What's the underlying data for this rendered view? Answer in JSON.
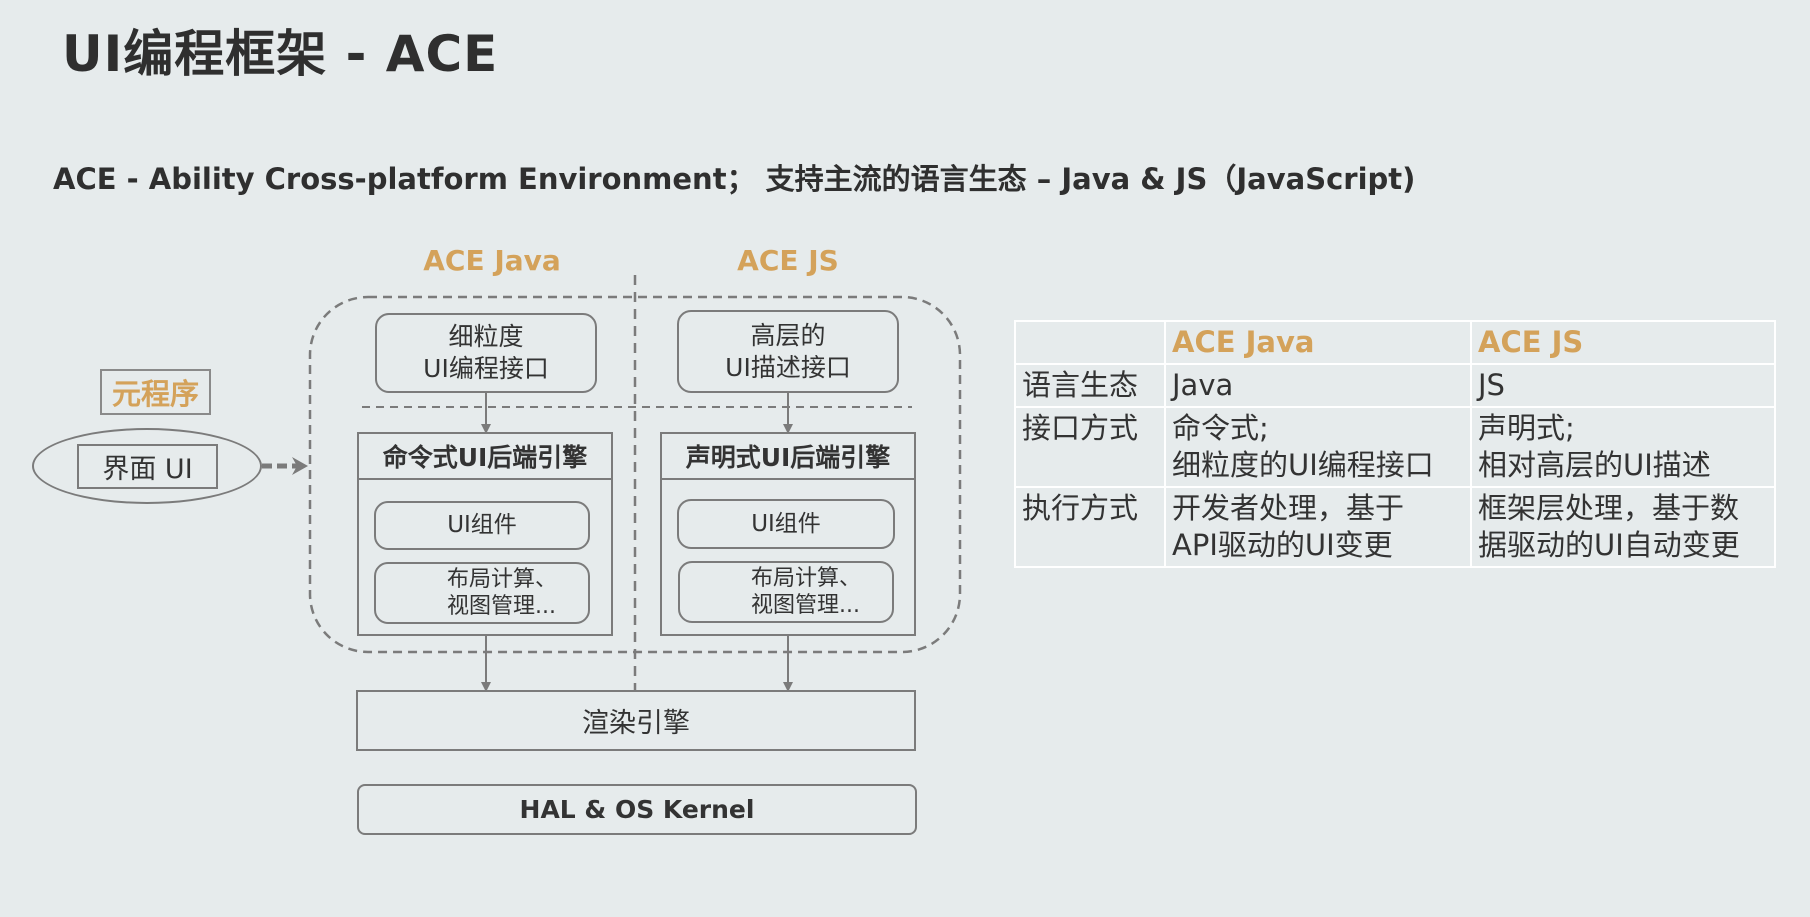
{
  "header": {
    "title": "UI编程框架 - ACE",
    "subtitle_prefix": "ACE  - Ability Cross-platform Environment；",
    "subtitle_suffix": " 支持主流的语言生态 – Java & JS（JavaScript)"
  },
  "diagram": {
    "meta_label": "元程序",
    "ui_label": "界面 UI",
    "java": {
      "heading": "ACE Java",
      "api_box": [
        "细粒度",
        "UI编程接口"
      ],
      "engine_title": "命令式UI后端引擎",
      "component_label": "UI组件",
      "layout_box": [
        "布局计算、",
        "视图管理..."
      ]
    },
    "js": {
      "heading": "ACE JS",
      "api_box": [
        "高层的",
        "UI描述接口"
      ],
      "engine_title": "声明式UI后端引擎",
      "component_label": "UI组件",
      "layout_box": [
        "布局计算、",
        "视图管理..."
      ]
    },
    "render_engine": "渲染引擎",
    "kernel": "HAL & OS Kernel"
  },
  "table": {
    "headers": [
      "",
      "ACE  Java",
      "ACE JS"
    ],
    "rows": [
      {
        "label": "语言生态",
        "java": [
          "Java"
        ],
        "js": [
          "JS"
        ]
      },
      {
        "label": "接口方式",
        "java": [
          "命令式;",
          "细粒度的UI编程接口"
        ],
        "js": [
          "声明式;",
          "相对高层的UI描述"
        ]
      },
      {
        "label": "执行方式",
        "java": [
          "开发者处理，基于",
          "API驱动的UI变更"
        ],
        "js": [
          "框架层处理，基于数",
          "据驱动的UI自动变更"
        ]
      }
    ]
  },
  "colors": {
    "background": "#e6ebec",
    "accent": "#d4a25a",
    "line": "#7b7b7b",
    "table_border": "#ffffff"
  }
}
